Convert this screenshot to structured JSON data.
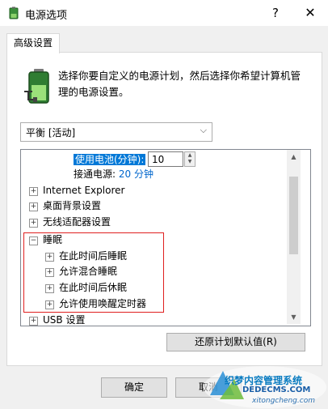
{
  "window": {
    "title": "电源选项",
    "help_label": "?",
    "close_label": "✕"
  },
  "tab": {
    "label": "高级设置"
  },
  "description": "选择你要自定义的电源计划，然后选择你希望计算机管理的电源设置。",
  "plan_select": {
    "value": "平衡 [活动]"
  },
  "tree": {
    "battery_label": "使用电池(分钟):",
    "battery_value": "10",
    "plugged_label": "接通电源:",
    "plugged_value": "20 分钟",
    "items": [
      {
        "label": "Internet Explorer",
        "expander": "+"
      },
      {
        "label": "桌面背景设置",
        "expander": "+"
      },
      {
        "label": "无线适配器设置",
        "expander": "+"
      },
      {
        "label": "睡眠",
        "expander": "−"
      },
      {
        "label": "在此时间后睡眠",
        "expander": "+"
      },
      {
        "label": "允许混合睡眠",
        "expander": "+"
      },
      {
        "label": "在此时间后休眠",
        "expander": "+"
      },
      {
        "label": "允许使用唤醒定时器",
        "expander": "+"
      },
      {
        "label": "USB 设置",
        "expander": "+"
      }
    ]
  },
  "buttons": {
    "restore": "还原计划默认值(R)",
    "ok": "确定",
    "cancel": "取消"
  },
  "watermark": {
    "line1": "织梦内容管理系统",
    "line2": "DEDECMS.COM",
    "site": "xitongcheng.com"
  },
  "colors": {
    "accent": "#0078d7",
    "highlight_box": "#e02020"
  }
}
